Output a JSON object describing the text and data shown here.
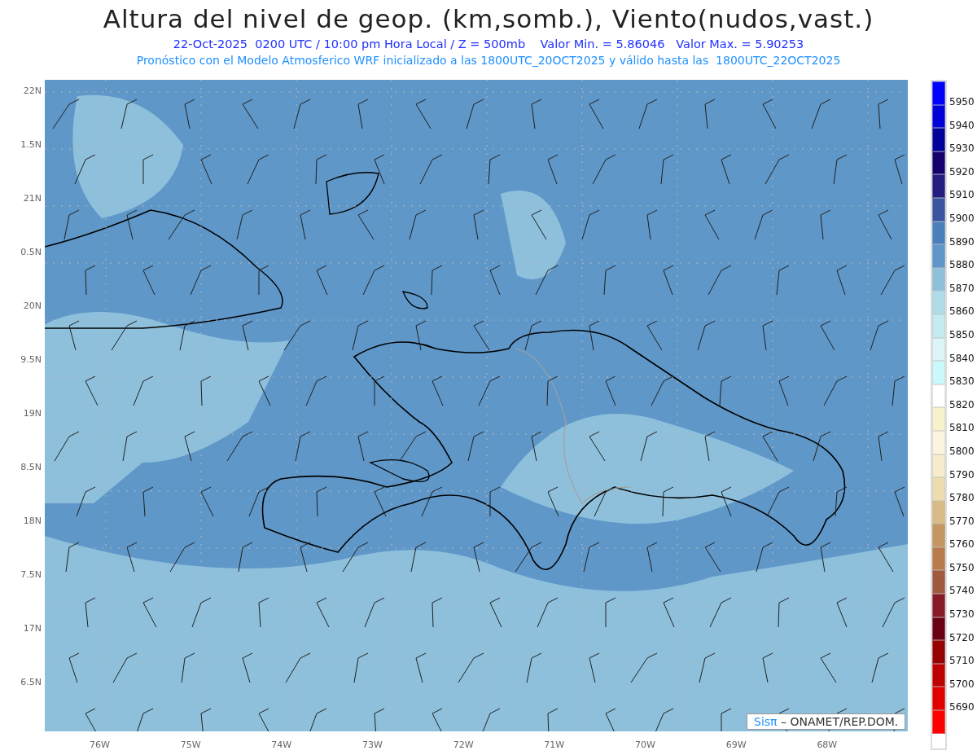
{
  "header": {
    "title": "Altura del nivel de geop. (km,somb.), Viento(nudos,vast.)",
    "subtitle": "22-Oct-2025  0200 UTC / 10:00 pm Hora Local / Z = 500mb    Valor Min. = 5.86046   Valor Max. = 5.90253",
    "forecast_line": "Pronóstico con el Modelo Atmosferico WRF inicializado a las 1800UTC_20OCT2025 y válido hasta las  1800UTC_22OCT2025"
  },
  "map": {
    "y_axis_labels": [
      "22N",
      "1.5N",
      "21N",
      "0.5N",
      "20N",
      "9.5N",
      "19N",
      "8.5N",
      "18N",
      "7.5N",
      "17N",
      "6.5N"
    ],
    "x_axis_labels": [
      "76W",
      "75W",
      "74W",
      "73W",
      "72W",
      "71W",
      "70W",
      "69W",
      "68W"
    ],
    "credit": {
      "brand": "Sisπ",
      "text": "– ONAMET/REP.DOM."
    }
  },
  "legend": [
    {
      "color": "#0000ff",
      "label": "5950"
    },
    {
      "color": "#0000d8",
      "label": "5940"
    },
    {
      "color": "#00009a",
      "label": "5930"
    },
    {
      "color": "#16006e",
      "label": "5920"
    },
    {
      "color": "#241c80",
      "label": "5910"
    },
    {
      "color": "#3a54a0",
      "label": "5900"
    },
    {
      "color": "#4a80bc",
      "label": "5890"
    },
    {
      "color": "#5f97c8",
      "label": "5880"
    },
    {
      "color": "#8ec0dc",
      "label": "5870"
    },
    {
      "color": "#b0dcea",
      "label": "5860"
    },
    {
      "color": "#c4eaf2",
      "label": "5850"
    },
    {
      "color": "#ddf4f8",
      "label": "5840"
    },
    {
      "color": "#cbf8fa",
      "label": "5830"
    },
    {
      "color": "#ffffff",
      "label": "5820"
    },
    {
      "color": "#f8f2cc",
      "label": "5810"
    },
    {
      "color": "#fbf5e0",
      "label": "5800"
    },
    {
      "color": "#f6eccb",
      "label": "5790"
    },
    {
      "color": "#ecdcb0",
      "label": "5780"
    },
    {
      "color": "#d9bb88",
      "label": "5770"
    },
    {
      "color": "#c49661",
      "label": "5760"
    },
    {
      "color": "#b87c4c",
      "label": "5750"
    },
    {
      "color": "#a05a40",
      "label": "5740"
    },
    {
      "color": "#861a28",
      "label": "5730"
    },
    {
      "color": "#6a0016",
      "label": "5720"
    },
    {
      "color": "#960000",
      "label": "5710"
    },
    {
      "color": "#bf0000",
      "label": "5700"
    },
    {
      "color": "#e00000",
      "label": "5690"
    },
    {
      "color": "#ff0000"
    }
  ]
}
